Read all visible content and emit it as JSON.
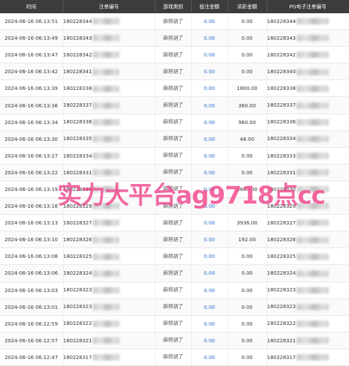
{
  "headers": {
    "time": "时间",
    "number": "注单编号",
    "game_type": "游戏类别",
    "bet_amount": "投注金额",
    "payout": "派彩金额",
    "pg_number": "PG电子注单编号"
  },
  "rows": [
    {
      "time": "2024-06-16 06:13:51",
      "number": "180228344",
      "game_type": "麻将胡了",
      "bet": "0.00",
      "payout": "0.00",
      "pg": "180228344"
    },
    {
      "time": "2024-06-16 06:13:49",
      "number": "180228343",
      "game_type": "麻将胡了",
      "bet": "0.00",
      "payout": "0.00",
      "pg": "180228343"
    },
    {
      "time": "2024-06-16 06:13:47",
      "number": "180228342",
      "game_type": "麻将胡了",
      "bet": "0.00",
      "payout": "0.00",
      "pg": "180228342"
    },
    {
      "time": "2024-06-16 06:13:42",
      "number": "180228341",
      "game_type": "麻将胡了",
      "bet": "0.00",
      "payout": "0.00",
      "pg": "180228340"
    },
    {
      "time": "2024-06-16 06:13:39",
      "number": "180228338",
      "game_type": "麻将胡了",
      "bet": "0.00",
      "payout": "1800.00",
      "pg": "180228338"
    },
    {
      "time": "2024-06-16 06:13:36",
      "number": "180228337",
      "game_type": "麻将胡了",
      "bet": "0.00",
      "payout": "360.00",
      "pg": "180228337"
    },
    {
      "time": "2024-06-16 06:13:34",
      "number": "180228336",
      "game_type": "麻将胡了",
      "bet": "0.00",
      "payout": "960.00",
      "pg": "180228336"
    },
    {
      "time": "2024-06-16 06:13:30",
      "number": "180228335",
      "game_type": "麻将胡了",
      "bet": "0.00",
      "payout": "48.00",
      "pg": "180228334"
    },
    {
      "time": "2024-06-16 06:13:27",
      "number": "180228334",
      "game_type": "麻将胡了",
      "bet": "0.00",
      "payout": "0.00",
      "pg": "180228333"
    },
    {
      "time": "2024-06-16 06:13:22",
      "number": "180228331",
      "game_type": "麻将胡了",
      "bet": "0.00",
      "payout": "0.00",
      "pg": "180228331"
    },
    {
      "time": "2024-06-16 06:13:19",
      "number": "180228330",
      "game_type": "麻将胡了",
      "bet": "0.00",
      "payout": "3600.00",
      "pg": "180228330"
    },
    {
      "time": "2024-06-16 06:13:16",
      "number": "180228329",
      "game_type": "麻将胡了",
      "bet": "0.00",
      "payout": "",
      "pg": "180228329"
    },
    {
      "time": "2024-06-16 06:13:13",
      "number": "180228327",
      "game_type": "麻将胡了",
      "bet": "0.00",
      "payout": "3936.00",
      "pg": "180228327"
    },
    {
      "time": "2024-06-16 06:13:10",
      "number": "180228326",
      "game_type": "麻将胡了",
      "bet": "0.00",
      "payout": "192.00",
      "pg": "180228326"
    },
    {
      "time": "2024-06-16 06:13:08",
      "number": "180228325",
      "game_type": "麻将胡了",
      "bet": "0.00",
      "payout": "0.00",
      "pg": "180228325"
    },
    {
      "time": "2024-06-16 06:13:06",
      "number": "180228324",
      "game_type": "麻将胡了",
      "bet": "0.00",
      "payout": "0.00",
      "pg": "180228324"
    },
    {
      "time": "2024-06-16 06:13:03",
      "number": "180228323",
      "game_type": "麻将胡了",
      "bet": "0.00",
      "payout": "0.00",
      "pg": "180228323"
    },
    {
      "time": "2024-06-16 06:13:01",
      "number": "180228323",
      "game_type": "麻将胡了",
      "bet": "0.00",
      "payout": "0.00",
      "pg": "180228323"
    },
    {
      "time": "2024-06-16 06:12:59",
      "number": "180228322",
      "game_type": "麻将胡了",
      "bet": "0.00",
      "payout": "0.00",
      "pg": "180228322"
    },
    {
      "time": "2024-06-16 06:12:57",
      "number": "180228321",
      "game_type": "麻将胡了",
      "bet": "0.00",
      "payout": "0.00",
      "pg": "180228321"
    },
    {
      "time": "2024-06-16 06:12:47",
      "number": "180228317",
      "game_type": "麻将胡了",
      "bet": "0.00",
      "payout": "0.00",
      "pg": "180228317"
    }
  ],
  "watermark": "实力大平台ag9718点cc"
}
